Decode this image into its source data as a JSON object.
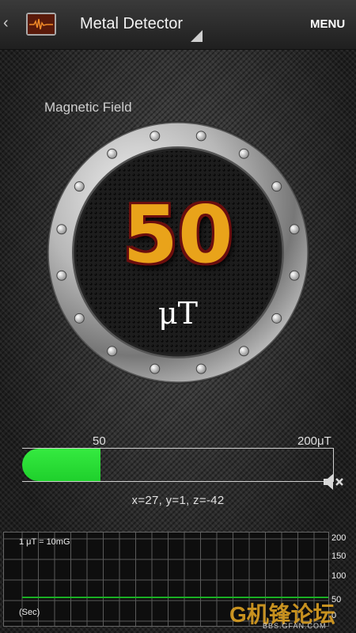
{
  "actionbar": {
    "back": "‹",
    "title": "Metal Detector",
    "menu": "MENU"
  },
  "gauge": {
    "label": "Magnetic Field",
    "value": "50",
    "unit": "μT"
  },
  "meter": {
    "current_label": "50",
    "max_label": "200μT",
    "fraction": 0.25,
    "color": "#1fd02c"
  },
  "axes": {
    "text": "x=27,  y=1,  z=-42"
  },
  "graph": {
    "note": "1 μT = 10mG",
    "x_label": "(Sec)",
    "y_ticks": [
      "200",
      "150",
      "100",
      "50",
      "0"
    ],
    "line_value": 50,
    "line_color": "#19b023"
  },
  "watermark": {
    "text": "G机锋论坛",
    "sub": "BBS.GFAN.COM"
  }
}
